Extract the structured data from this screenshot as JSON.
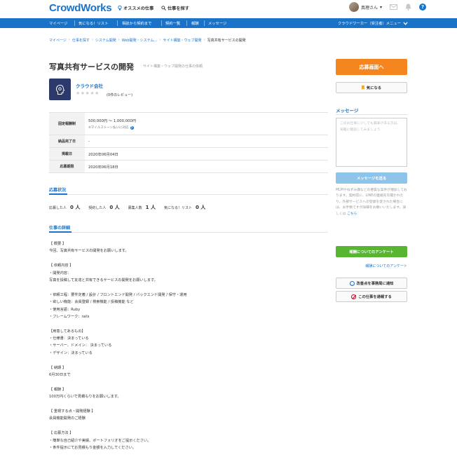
{
  "header": {
    "logo": "CrowdWorks",
    "recommend_link": "オススメの仕事",
    "search_link": "仕事を探す",
    "user_name": "真理さん",
    "help_label": "?"
  },
  "nav": {
    "items": [
      "マイページ",
      "気になる！リスト",
      "相談から契約まで",
      "契約一覧",
      "報酬",
      "メッセージ"
    ],
    "right_menu": "クラウドワーカー（受注者）メニュー"
  },
  "breadcrumb": [
    "マイページ",
    "仕事を探す",
    "システム開発",
    "Web開発・システム…",
    "サイト構築・ウェブ開発",
    "写真共有サービスの開発"
  ],
  "job": {
    "title": "写真共有サービスの開発",
    "subtitle": "サイト構築・ウェブ開発の仕事の依頼"
  },
  "client": {
    "name": "クラウド会社",
    "stars": "★★★★★",
    "reviews": "(0件のレビュー)"
  },
  "info": {
    "budget_label": "固定報酬制",
    "budget_value": "500,000円 〜 1,000,000円",
    "budget_note": "※マイルストーン払いに対応",
    "delivery_label": "納品完了日",
    "delivery_value": "-",
    "posted_label": "掲載日",
    "posted_value": "2020年06月04日",
    "deadline_label": "応募期限",
    "deadline_value": "2020年06月18日"
  },
  "status": {
    "heading": "応募状況",
    "applicants_label": "応募した人",
    "applicants_value": "0 人",
    "contracted_label": "契約した人",
    "contracted_value": "0 人",
    "recruit_label": "募集人数",
    "recruit_value": "1 人",
    "fav_label": "気になる！リスト",
    "fav_value": "0 人"
  },
  "detail": {
    "heading": "仕事の詳細",
    "lines": [
      "【 概要 】",
      "今回、写真共有サービスの開発をお願いします。",
      "",
      "【 依頼内容 】",
      "・開発内容：",
      "写真を投稿して友達と共有できるサービスの開発をお願いします。",
      "",
      "・依頼工程：要件定義 / 設計 / フロントエンド開発 / バックエンド開発 / 保守・運用",
      "・欲しい機能：会員登録 / 検索機能 / 投稿機能 など",
      "・使用言語：Ruby",
      "・フレームワーク：rails",
      "",
      "【用意してあるもの】",
      "・仕様書：決まっている",
      "・サーバー、ドメイン： 決まっている",
      "・デザイン：決まっている",
      "",
      "【 納期 】",
      "6月30日まで",
      "",
      "【 報酬 】",
      "100万円くらいで見積もりをお願いします。",
      "",
      "【 重視する点・開発経験 】",
      "会員機能開発のご経験",
      "",
      "【 応募方法 】",
      "・簡単な自己紹介や実績、ポートフォリオをご提示ください。",
      "・条件提示にてお見積もり金額を入力してください。"
    ]
  },
  "sidebar": {
    "apply_button": "応募画面へ",
    "fav_button": "気になる",
    "message_heading": "メッセージ",
    "message_placeholder": "このお仕事に少しでも興味がある方は、気軽に相談してみましょう",
    "send_button": "メッセージを送る",
    "notice_text": "MLMやねずみ講などの悪質な案件が増加しております。契約前に、LINEの連絡先を聞かれたり、外部サービスへの登録を促された場合には、お手数ですが詳細をお願いいたします。詳しくは",
    "notice_link": "こちら",
    "survey_button": "報酬についてのアンケート",
    "survey_link": "報酬についてのアンケート",
    "improve_button": "改善点を事務局に通知",
    "report_button": "この仕事を通報する"
  },
  "colors": {
    "brand_blue": "#1a73c8",
    "apply_orange": "#f5851f",
    "survey_green": "#58b531"
  }
}
